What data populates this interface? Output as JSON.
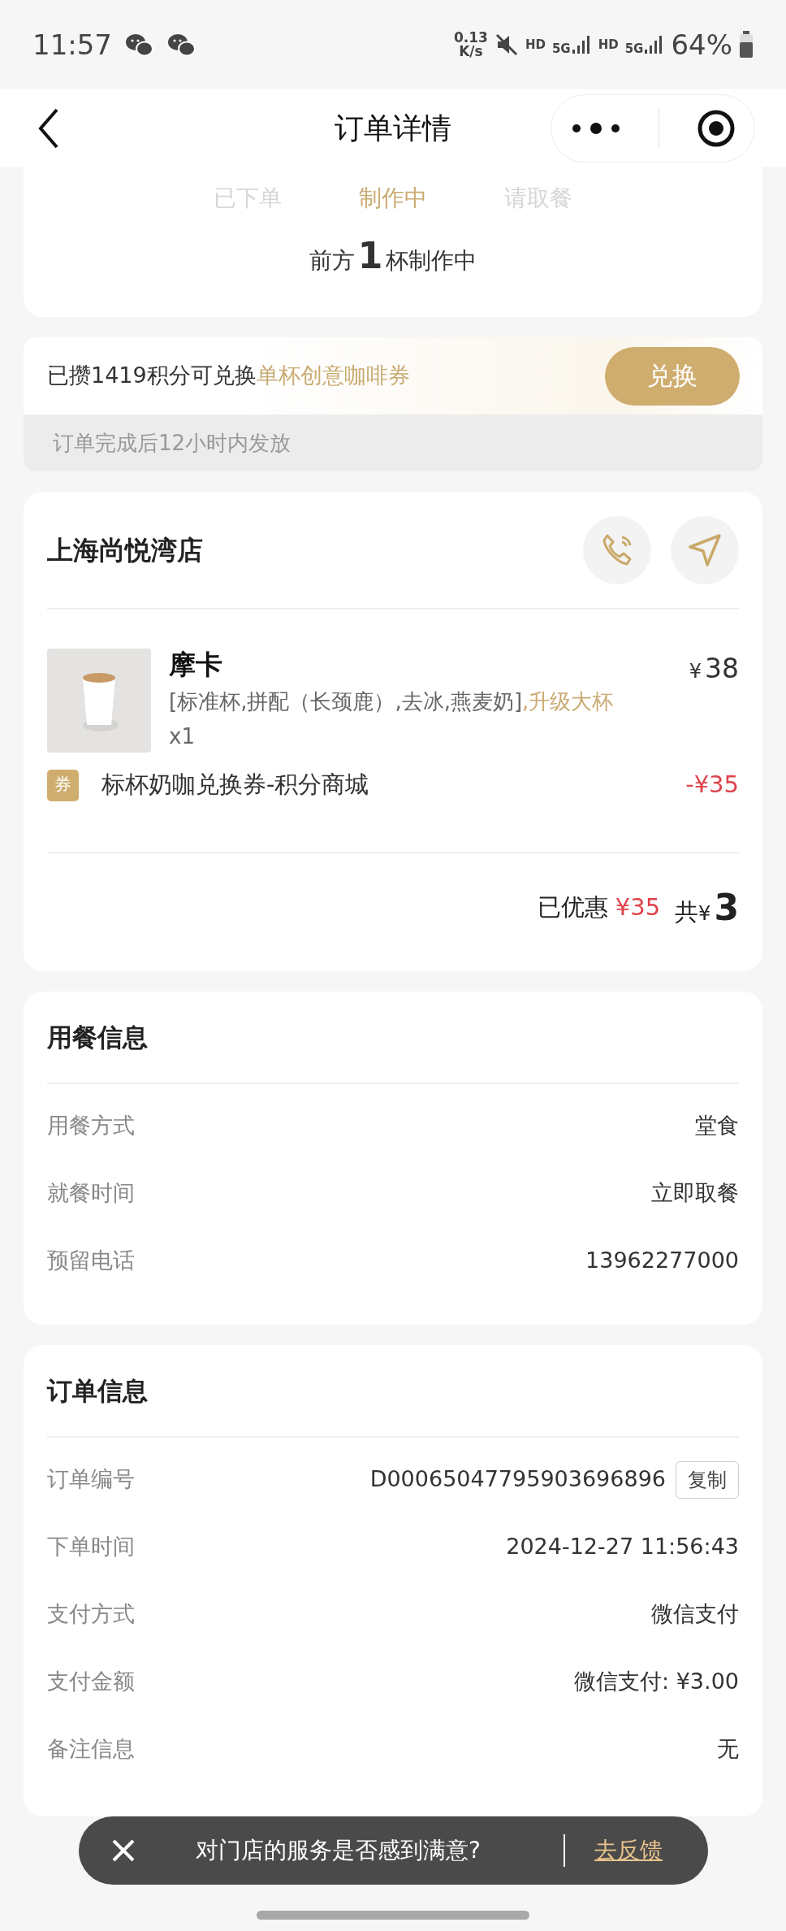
{
  "status_bar": {
    "time": "11:57",
    "net_speed": "0.13",
    "net_speed_unit": "K/s",
    "hd_1": "HD",
    "network_1": "5G",
    "hd_2": "HD",
    "network_2": "5G",
    "battery": "64%"
  },
  "header": {
    "title": "订单详情"
  },
  "progress": {
    "steps": [
      {
        "label": "已下单",
        "selected": false
      },
      {
        "label": "制作中",
        "selected": true
      },
      {
        "label": "请取餐",
        "selected": false
      }
    ],
    "queue_prefix": "前方",
    "queue_count": "1",
    "queue_suffix": "杯制作中"
  },
  "points": {
    "text": "已攒1419积分可兑换",
    "highlight": "单杯创意咖啡券",
    "button": "兑换",
    "note": "订单完成后12小时内发放"
  },
  "store": {
    "name": "上海尚悦湾店",
    "items": [
      {
        "name": "摩卡",
        "options": "[标准杯,拼配（长颈鹿）,去冰,燕麦奶]",
        "upgrade": ",升级大杯",
        "qty": "x1",
        "currency": "¥",
        "price": "38"
      }
    ],
    "coupon": {
      "badge": "券",
      "name": "标杯奶咖兑换券-积分商城",
      "amount": "-¥35"
    },
    "discount_label": "已优惠",
    "discount": "¥35",
    "total_label": "共",
    "total_currency": "¥",
    "total": "3"
  },
  "dining_info": {
    "title": "用餐信息",
    "rows": [
      {
        "label": "用餐方式",
        "value": "堂食"
      },
      {
        "label": "就餐时间",
        "value": "立即取餐"
      },
      {
        "label": "预留电话",
        "value": "13962277000"
      }
    ]
  },
  "order_info": {
    "title": "订单信息",
    "rows": [
      {
        "label": "订单编号",
        "value": "D00065047795903696896",
        "action": "复制"
      },
      {
        "label": "下单时间",
        "value": "2024-12-27 11:56:43"
      },
      {
        "label": "支付方式",
        "value": "微信支付"
      },
      {
        "label": "支付金额",
        "value": "微信支付: ¥3.00"
      },
      {
        "label": "备注信息",
        "value": "无"
      }
    ]
  },
  "toast": {
    "text": "对门店的服务是否感到满意?",
    "action": "去反馈"
  }
}
